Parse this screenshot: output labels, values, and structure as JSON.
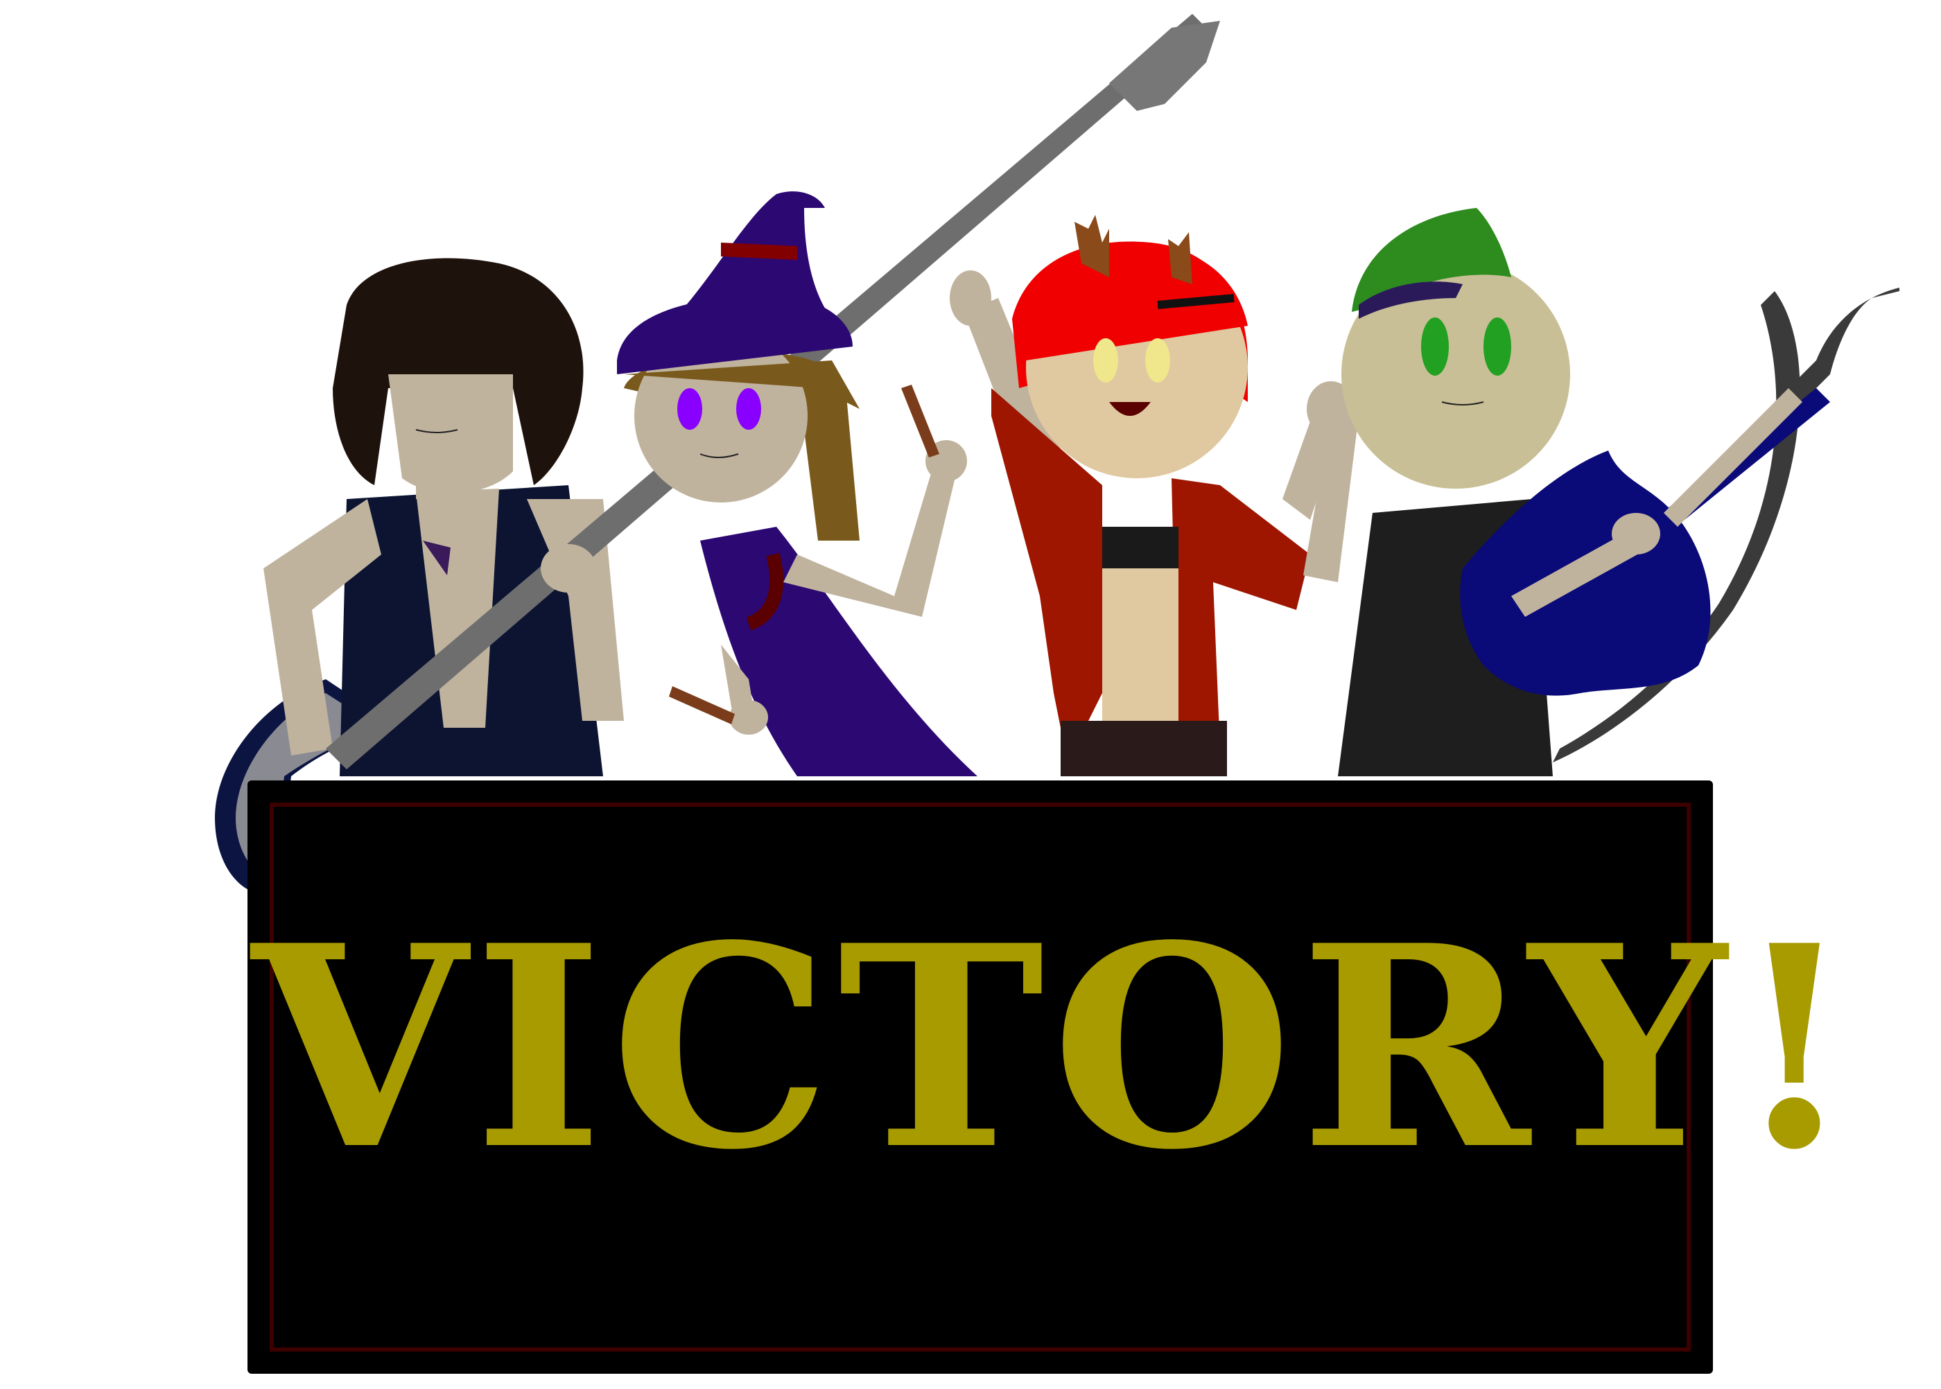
{
  "scene": {
    "banner_text": "VICTORY!",
    "banner_text_color": "#a89b00",
    "banner_bg": "#000000",
    "banner_border": "#3c0000",
    "band_members": [
      {
        "role": "bassist",
        "hair": "#1e120c",
        "vest": "#0c1432",
        "skin": "#c0b39e",
        "instrument": "bass-guitar"
      },
      {
        "role": "witch",
        "hat": "#2c0873",
        "hat_band": "#820000",
        "dress": "#2c0873",
        "eyes": "#8a00ff",
        "hair": "#7a5a1c",
        "instrument": "drumsticks"
      },
      {
        "role": "red-haired-singer",
        "hair": "#f00000",
        "horns": "#8a4a1a",
        "jacket": "#9e1600",
        "eyes": "#f0e68c",
        "instrument": "none"
      },
      {
        "role": "green-haired-guitarist",
        "hair": "#2e8c1e",
        "shirt": "#1e1e1e",
        "eyes": "#22a022",
        "guitar": "#0a0a78",
        "scythe": "#3a3a3a",
        "instrument": "electric-guitar"
      }
    ]
  }
}
